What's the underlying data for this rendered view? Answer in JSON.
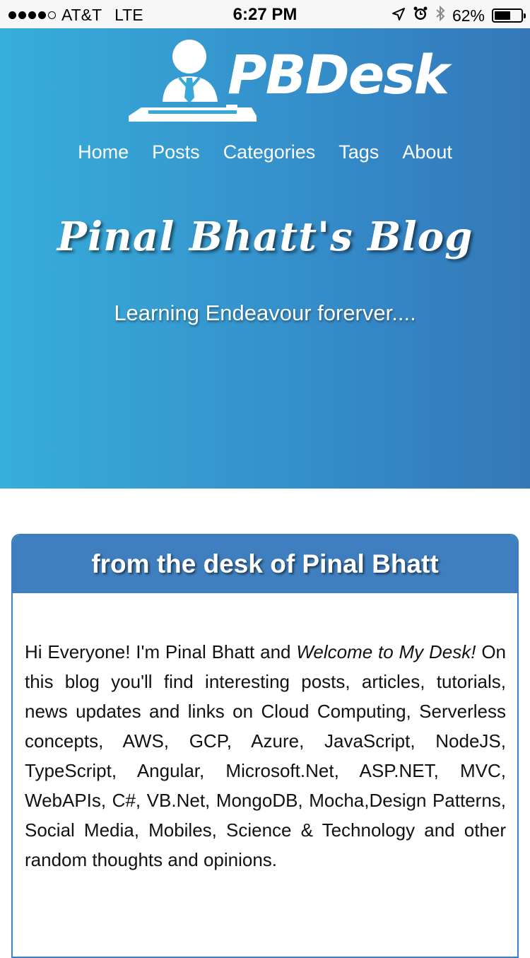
{
  "status_bar": {
    "carrier": "AT&T",
    "network": "LTE",
    "time": "6:27 PM",
    "battery_percent": "62%",
    "battery_level": 0.62,
    "icons": [
      "signal-dots",
      "location-arrow-icon",
      "alarm-clock-icon",
      "bluetooth-icon",
      "battery-icon"
    ]
  },
  "header": {
    "logo_text": "PBDesk",
    "nav": [
      {
        "label": "Home"
      },
      {
        "label": "Posts"
      },
      {
        "label": "Categories"
      },
      {
        "label": "Tags"
      },
      {
        "label": "About"
      }
    ],
    "blog_title": "Pinal Bhatt's Blog",
    "tagline": "Learning Endeavour forerver....",
    "gradient_colors": [
      "#37aedb",
      "#3478b8"
    ]
  },
  "card": {
    "title": "from the desk of Pinal Bhatt",
    "intro_plain": "Hi Everyone! I'm Pinal Bhatt and ",
    "intro_emphasis": "Welcome to My Desk!",
    "body": "On this blog you'll find interesting posts, articles, tutorials, news updates and links on Cloud Computing, Serverless concepts, AWS, GCP, Azure, JavaScript, NodeJS, TypeScript, Angular, Microsoft.Net, ASP.NET, MVC, WebAPIs, C#, VB.Net, MongoDB, Mocha,Design Patterns, Social Media, Mobiles, Science & Technology and other random thoughts and opinions.",
    "header_color": "#3f7fbf"
  }
}
